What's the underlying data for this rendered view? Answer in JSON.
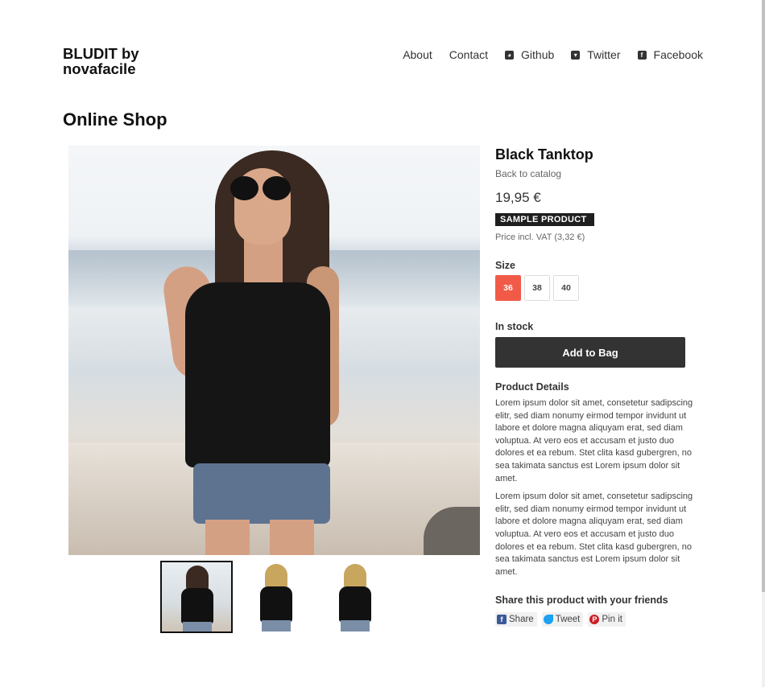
{
  "header": {
    "site_title": "BLUDIT by novafacile",
    "nav": [
      {
        "label": "About",
        "icon": ""
      },
      {
        "label": "Contact",
        "icon": ""
      },
      {
        "label": "Github",
        "icon": "github-icon"
      },
      {
        "label": "Twitter",
        "icon": "twitter-icon"
      },
      {
        "label": "Facebook",
        "icon": "facebook-icon"
      }
    ]
  },
  "page": {
    "title": "Online Shop"
  },
  "product": {
    "name": "Black Tanktop",
    "back_link": "Back to catalog",
    "price": "19,95 €",
    "badge": "SAMPLE PRODUCT",
    "vat": "Price incl. VAT (3,32 €)",
    "size_label": "Size",
    "sizes": [
      {
        "label": "36",
        "selected": true
      },
      {
        "label": "38",
        "selected": false
      },
      {
        "label": "40",
        "selected": false
      }
    ],
    "stock": "In stock",
    "add_to_bag": "Add to Bag",
    "details_title": "Product Details",
    "details_paragraphs": [
      "Lorem ipsum dolor sit amet, consetetur sadipscing elitr, sed diam nonumy eirmod tempor invidunt ut labore et dolore magna aliquyam erat, sed diam voluptua. At vero eos et accusam et justo duo dolores et ea rebum. Stet clita kasd gubergren, no sea takimata sanctus est Lorem ipsum dolor sit amet.",
      "Lorem ipsum dolor sit amet, consetetur sadipscing elitr, sed diam nonumy eirmod tempor invidunt ut labore et dolore magna aliquyam erat, sed diam voluptua. At vero eos et accusam et justo duo dolores et ea rebum. Stet clita kasd gubergren, no sea takimata sanctus est Lorem ipsum dolor sit amet."
    ],
    "share_title": "Share this product with your friends",
    "share_buttons": [
      {
        "label": "Share",
        "icon": "facebook-icon"
      },
      {
        "label": "Tweet",
        "icon": "twitter-icon"
      },
      {
        "label": "Pin it",
        "icon": "pinterest-icon"
      }
    ]
  },
  "gallery": {
    "main_image": "woman-beach-black-tanktop",
    "thumbnails": [
      "woman-beach-black-tanktop",
      "blonde-model-front-black-tanktop",
      "blonde-model-back-black-tanktop"
    ],
    "active_thumbnail": 0
  },
  "colors": {
    "accent": "#f15a47",
    "button": "#333333",
    "badge": "#1f1f1f"
  }
}
